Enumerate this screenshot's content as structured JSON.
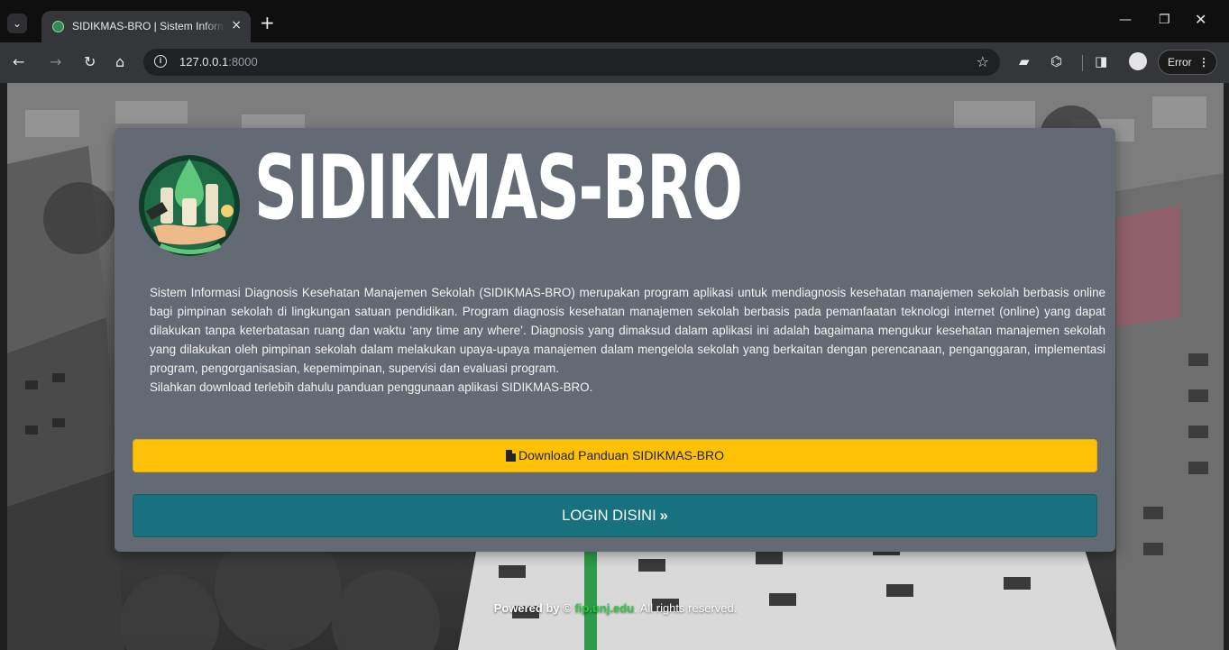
{
  "browser": {
    "tab_title": "SIDIKMAS-BRO | Sistem Informasi",
    "tab_close": "×",
    "new_tab": "+",
    "url_host": "127.0.0.1",
    "url_port": ":8000",
    "error_label": "Error",
    "icons": [
      "tab-list-icon",
      "favicon-icon",
      "back-icon",
      "forward-icon",
      "reload-icon",
      "home-icon",
      "info-icon",
      "star-icon",
      "extension-icon",
      "puzzle-icon",
      "side-panel-icon",
      "profile-icon",
      "menu-icon",
      "minimize-icon",
      "restore-icon",
      "close-icon"
    ]
  },
  "page": {
    "brand_title": "SIDIKMAS-BRO",
    "description": "Sistem Informasi Diagnosis Kesehatan Manajemen Sekolah (SIDIKMAS-BRO) merupakan program aplikasi untuk mendiagnosis kesehatan manajemen sekolah berbasis online bagi pimpinan sekolah di lingkungan satuan pendidikan. Program diagnosis kesehatan manajemen sekolah berbasis pada pemanfaatan teknologi internet (online) yang dapat dilakukan tanpa keterbatasan ruang dan waktu ‘any time any where’. Diagnosis yang dimaksud dalam aplikasi ini adalah bagaimana mengukur kesehatan manajemen sekolah yang dilakukan oleh pimpinan sekolah dalam melakukan upaya-upaya manajemen dalam mengelola sekolah yang berkaitan dengan perencanaan, penganggaran, implementasi program, pengorganisasian, kepemimpinan, supervisi dan evaluasi program.",
    "download_note": "Silahkan download terlebih dahulu panduan penggunaan aplikasi SIDIKMAS-BRO.",
    "download_button": "Download Panduan SIDIKMAS-BRO",
    "login_button": "LOGIN DISINI",
    "login_chevron": "»"
  },
  "footer": {
    "powered_by": "Powered by ©",
    "link": "fip.unj.edu",
    "rights": ". All rights reserved."
  },
  "colors": {
    "card": "#646a73",
    "download": "#ffc107",
    "login": "#17717f",
    "footer_link": "#2ecc40"
  }
}
